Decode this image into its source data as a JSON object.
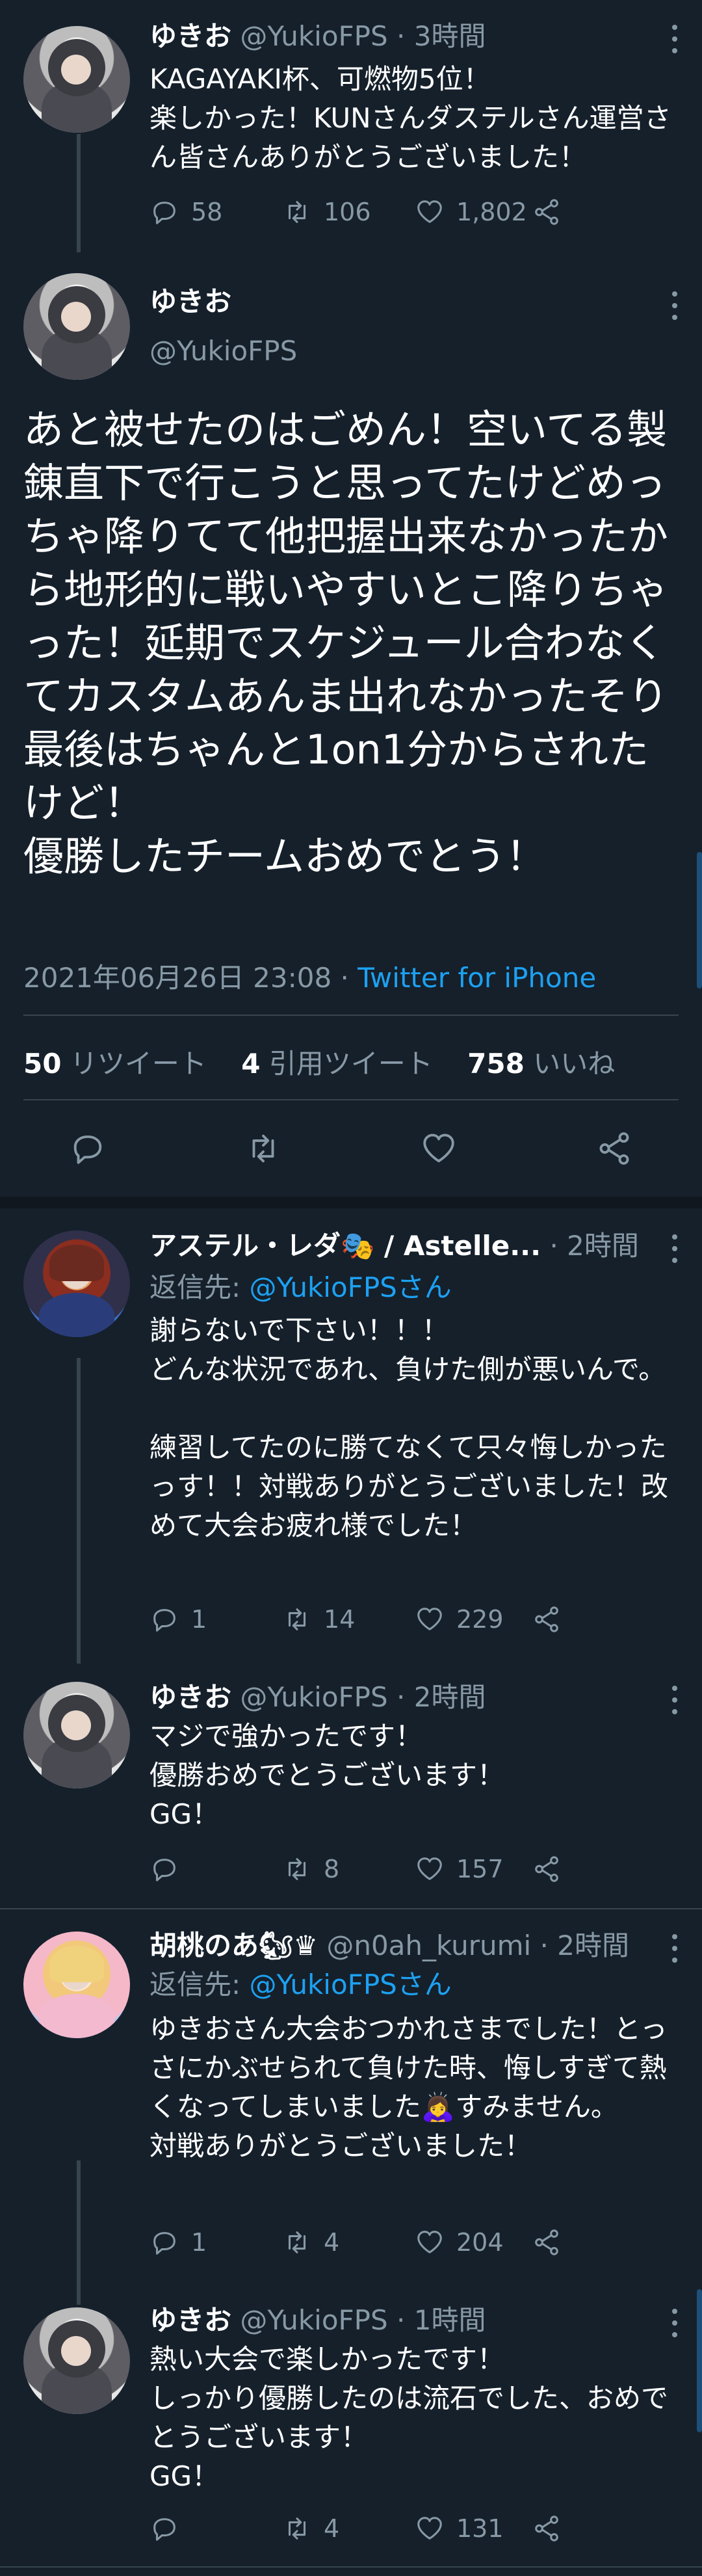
{
  "tweets": [
    {
      "name": "ゆきお",
      "handle": "@YukioFPS",
      "sep": " · ",
      "time": "3時間",
      "text": "KAGAYAKI杯、可燃物5位！\n楽しかった！KUNさんダステルさん運営さん皆さんありがとうございました！",
      "replies": "58",
      "retweets": "106",
      "likes": "1,802"
    },
    {
      "name": "アステル・レダ🎭 / Astelle...",
      "handle": "",
      "sep": " · ",
      "time": "2時間",
      "reply_label": "返信先: ",
      "reply_to": "@YukioFPSさん",
      "text": "謝らないで下さい！！！\nどんな状況であれ、負けた側が悪いんで。\n\n練習してたのに勝てなくて只々悔しかったっす！！対戦ありがとうございました！改めて大会お疲れ様でした！",
      "replies": "1",
      "retweets": "14",
      "likes": "229"
    },
    {
      "name": "ゆきお",
      "handle": "@YukioFPS",
      "sep": " · ",
      "time": "2時間",
      "text": "マジで強かったです！\n優勝おめでとうございます！\nGG！",
      "replies": "",
      "retweets": "8",
      "likes": "157"
    },
    {
      "name": "胡桃のあ🐿♛",
      "handle": "@n0ah_kurumi",
      "sep": " · ",
      "time": "2時間",
      "reply_label": "返信先: ",
      "reply_to": "@YukioFPSさん",
      "text": "ゆきおさん大会おつかれさまでした！とっさにかぶせられて負けた時、悔しすぎて熱くなってしまいました🙇‍♀️すみません。\n対戦ありがとうございました！",
      "replies": "1",
      "retweets": "4",
      "likes": "204"
    },
    {
      "name": "ゆきお",
      "handle": "@YukioFPS",
      "sep": " · ",
      "time": "1時間",
      "text": "熱い大会で楽しかったです！\nしっかり優勝したのは流石でした、おめでとうございます！\nGG！",
      "replies": "",
      "retweets": "4",
      "likes": "131"
    }
  ],
  "main_tweet": {
    "name": "ゆきお",
    "handle": "@YukioFPS",
    "text": "あと被せたのはごめん！空いてる製錬直下で行こうと思ってたけどめっちゃ降りてて他把握出来なかったから地形的に戦いやすいとこ降りちゃった！延期でスケジュール合わなくてカスタムあんま出れなかったそり\n最後はちゃんと1on1分からされたけど！\n優勝したチームおめでとう！",
    "date": "2021年06月26日 23:08 · ",
    "client": "Twitter for iPhone",
    "retweets_count": "50",
    "retweets_label": "リツイート",
    "quotes_count": "4",
    "quotes_label": "引用ツイート",
    "likes_count": "758",
    "likes_label": "いいね"
  },
  "colors": {
    "background": "#15202b",
    "secondary_text": "#8899a6",
    "link": "#1da1f2",
    "divider": "#38444d"
  }
}
